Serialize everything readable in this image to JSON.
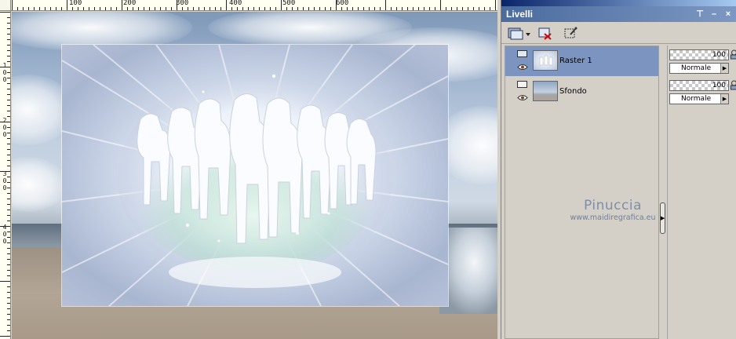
{
  "ruler": {
    "h_labels": [
      "100",
      "200",
      "300",
      "400",
      "500",
      "600"
    ],
    "v_labels": [
      [
        "1",
        "0",
        "0"
      ],
      [
        "2",
        "0",
        "0"
      ],
      [
        "3",
        "0",
        "0"
      ],
      [
        "4",
        "0",
        "0"
      ]
    ]
  },
  "panel": {
    "title": "Livelli",
    "buttons": {
      "pin": "⊤",
      "minimize": "–",
      "close": "×"
    }
  },
  "toolbar": {
    "icons": [
      "new-layer-icon",
      "delete-layer-icon",
      "layer-properties-icon"
    ]
  },
  "layers": [
    {
      "name": "Raster 1",
      "opacity": "100",
      "blend": "Normale",
      "selected": true
    },
    {
      "name": "Sfondo",
      "opacity": "100",
      "blend": "Normale",
      "selected": false
    }
  ],
  "watermark": {
    "name": "Pinuccia",
    "url": "www.maidiregrafica.eu"
  },
  "colors": {
    "selection": "#7c95c0",
    "title_bar": "#4a6b9e",
    "panel_bg": "#d4d0c8"
  }
}
